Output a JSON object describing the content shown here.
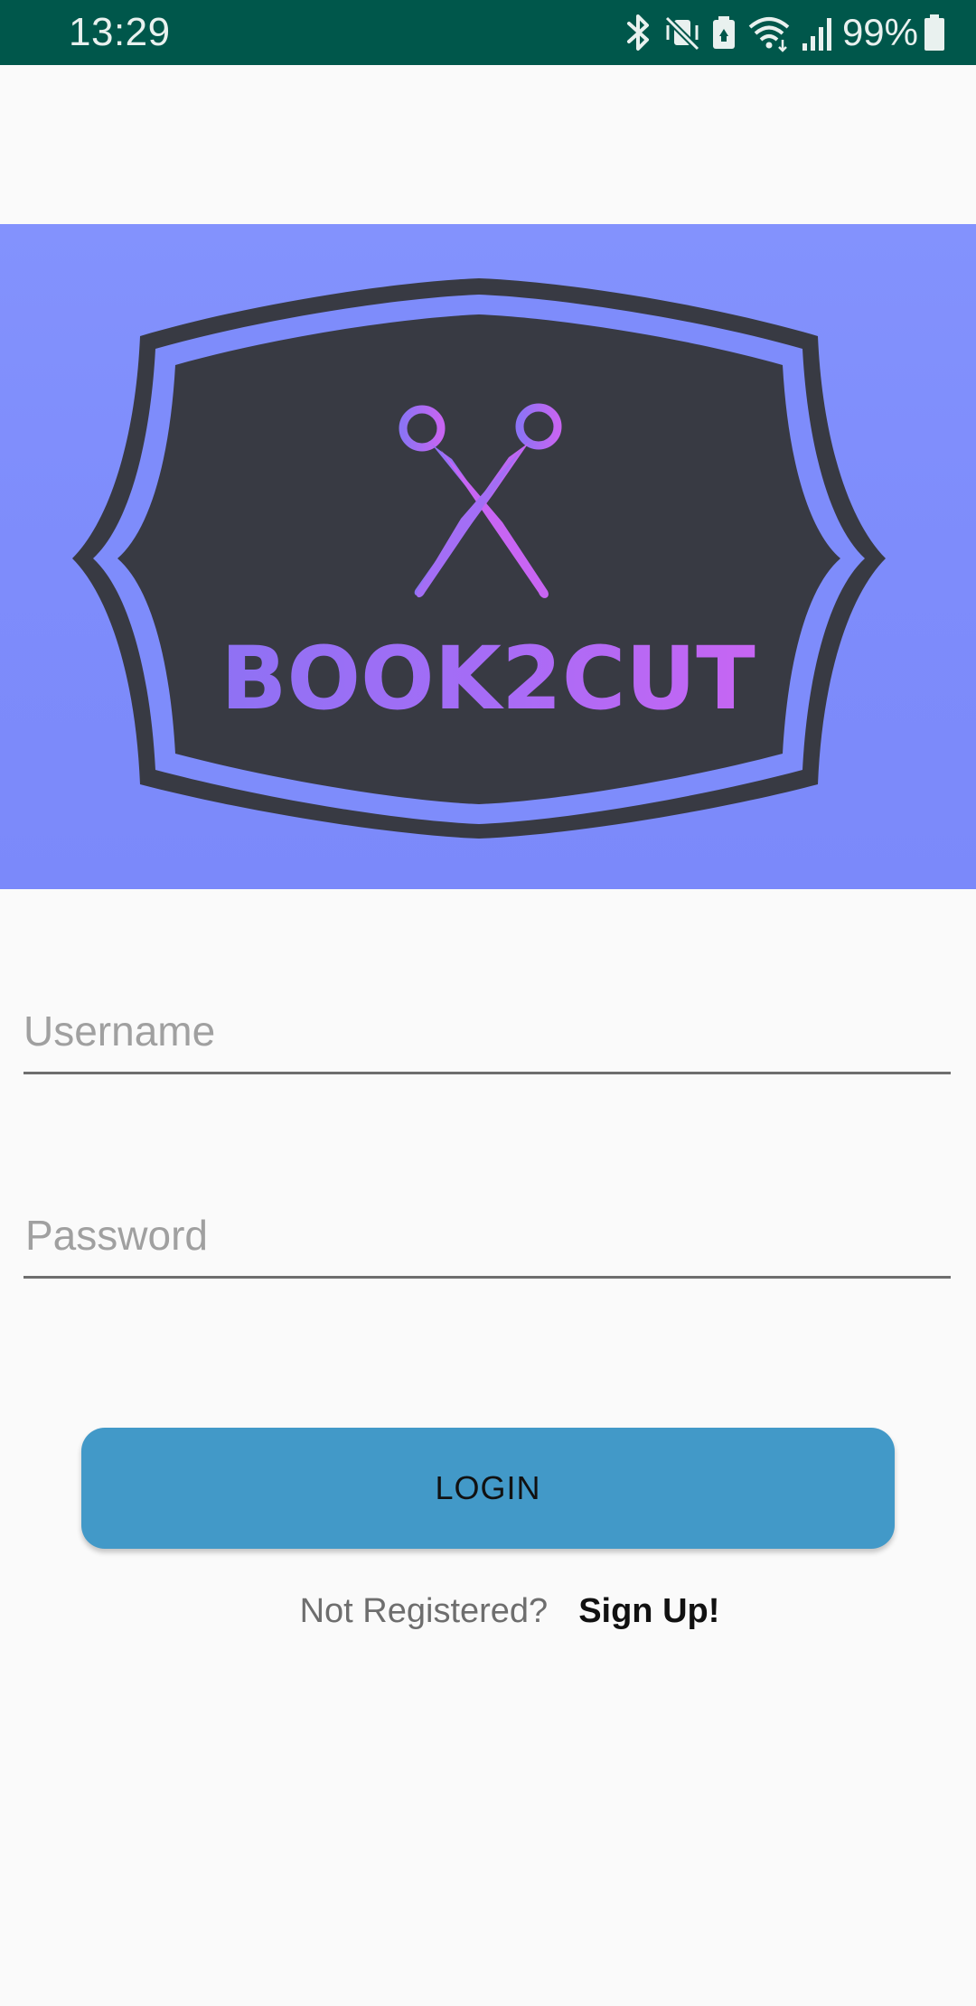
{
  "status_bar": {
    "time": "13:29",
    "battery_percent": "99%",
    "icons": [
      "bluetooth-icon",
      "vibrate-mute-icon",
      "battery-saver-icon",
      "wifi-icon",
      "signal-icon",
      "battery-icon"
    ],
    "background_color": "#00574b"
  },
  "banner": {
    "brand_name": "BOOK2CUT",
    "icon": "scissors-icon",
    "background_color": "#7f8dfc",
    "badge_color": "#383a43"
  },
  "login_form": {
    "username_placeholder": "Username",
    "password_placeholder": "Password",
    "login_label": "LOGIN",
    "login_button_color": "#4299c8"
  },
  "register": {
    "prompt": "Not Registered?",
    "link_label": "Sign Up!"
  }
}
